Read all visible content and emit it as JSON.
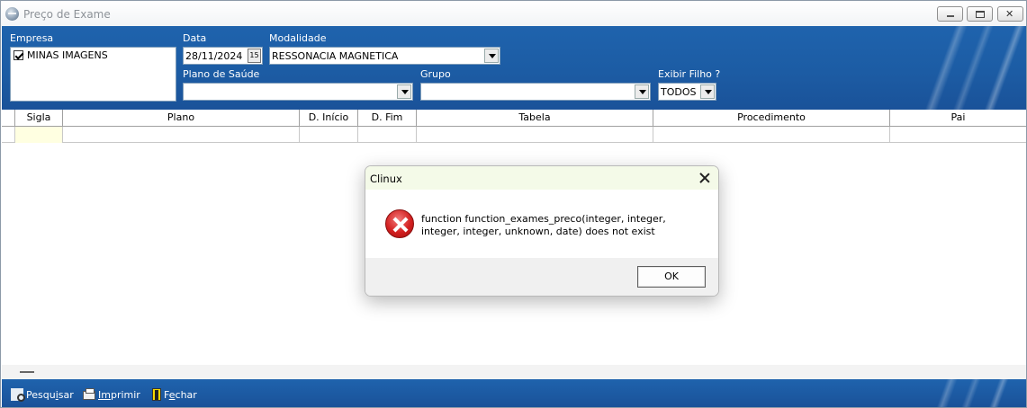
{
  "window": {
    "title": "Preço de Exame"
  },
  "filters": {
    "empresa": {
      "label": "Empresa",
      "items": [
        {
          "label": "MINAS IMAGENS",
          "checked": true
        }
      ]
    },
    "data": {
      "label": "Data",
      "value": "28/11/2024",
      "cal_glyph": "15"
    },
    "modalidade": {
      "label": "Modalidade",
      "value": "RESSONACIA MAGNETICA"
    },
    "plano_saude": {
      "label": "Plano de Saúde",
      "value": ""
    },
    "grupo": {
      "label": "Grupo",
      "value": ""
    },
    "exibir_filho": {
      "label": "Exibir Filho ?",
      "value": "TODOS"
    }
  },
  "grid": {
    "columns": [
      "Sigla",
      "Plano",
      "D. Início",
      "D. Fim",
      "Tabela",
      "Procedimento",
      "Pai"
    ],
    "rows": [
      [
        "",
        "",
        "",
        "",
        "",
        "",
        ""
      ]
    ]
  },
  "toolbar": {
    "pesquisar_pre": "Pesqu",
    "pesquisar_u": "i",
    "pesquisar_post": "sar",
    "imprimir_pre": "",
    "imprimir_u": "Im",
    "imprimir_post": "primir",
    "fechar_pre": "F",
    "fechar_u": "e",
    "fechar_post": "char"
  },
  "dialog": {
    "title": "Clinux",
    "message": "function function_exames_preco(integer, integer, integer, integer, unknown, date) does not exist",
    "ok_label": "OK"
  },
  "colors": {
    "panel_blue": "#1c5ca4",
    "dialog_title_bg": "#f4fae8",
    "error_red": "#d32020",
    "selected_cell": "#ffffe1"
  }
}
